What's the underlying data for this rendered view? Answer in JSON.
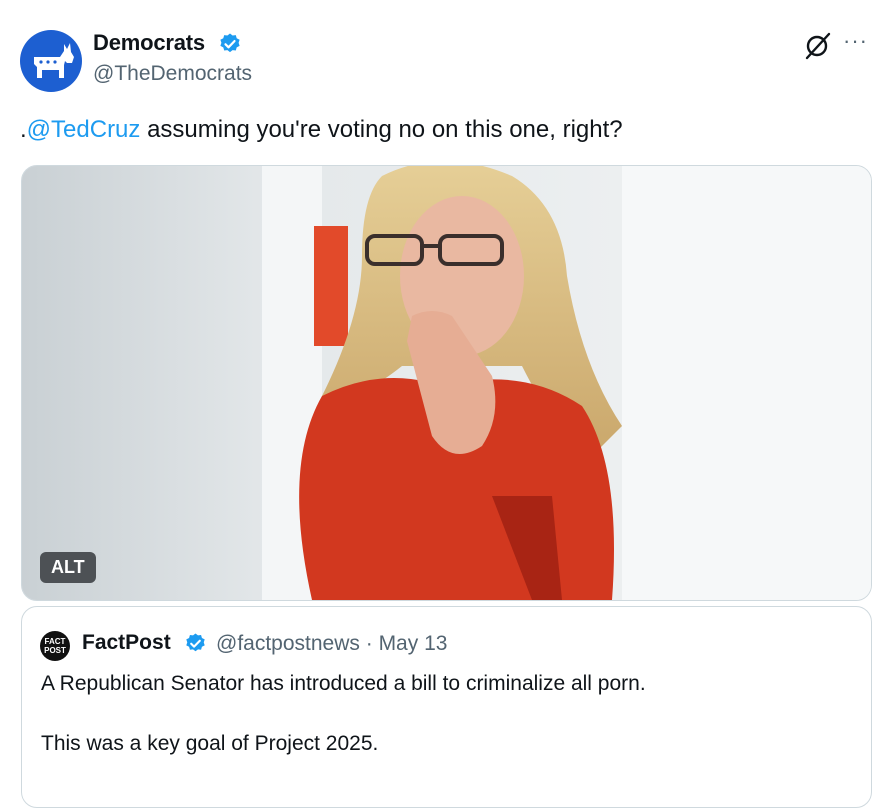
{
  "author": {
    "name": "Democrats",
    "handle": "@TheDemocrats",
    "avatar_icon": "donkey-logo-icon",
    "brand_color": "#1d5fd1"
  },
  "header_icons": {
    "grok": "grok-icon",
    "more": "···"
  },
  "tweet": {
    "prefix": ".",
    "mention": "@TedCruz",
    "body": " assuming you're voting no on this one, right?"
  },
  "media": {
    "alt_badge": "ALT"
  },
  "quote": {
    "name": "FactPost",
    "handle": "@factpostnews",
    "separator": " · ",
    "date": "May 13",
    "logo_text_1": "FACT",
    "logo_text_2": "POST",
    "line1": "A Republican Senator has introduced a bill to criminalize all porn.",
    "line2": "This was a key goal of Project 2025."
  },
  "colors": {
    "link": "#1d9bf0",
    "verified": "#1d9bf0",
    "muted": "#536471"
  }
}
